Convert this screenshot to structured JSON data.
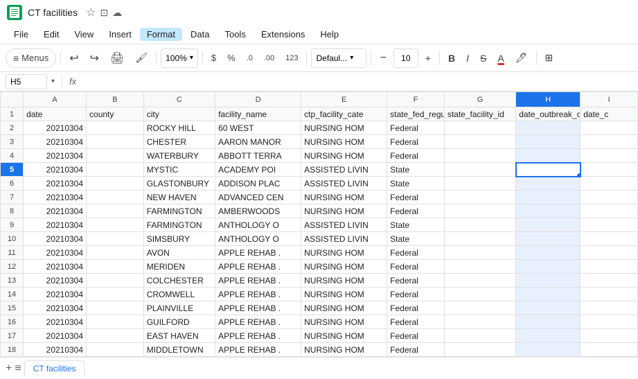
{
  "titleBar": {
    "title": "CT facilities",
    "icons": [
      "star",
      "doc",
      "cloud"
    ]
  },
  "menuBar": {
    "items": [
      "File",
      "Edit",
      "View",
      "Insert",
      "Format",
      "Data",
      "Tools",
      "Extensions",
      "Help"
    ]
  },
  "toolbar": {
    "menus": "Menus",
    "zoom": "100%",
    "currency": "$",
    "percent": "%",
    "decDecrease": ".0",
    "decIncrease": ".00",
    "num123": "123",
    "fontFamily": "Defaul...",
    "minus": "−",
    "fontSize": "10",
    "plus": "+",
    "bold": "B",
    "italic": "I",
    "strikethrough": "S",
    "underline": "A"
  },
  "formulaBar": {
    "cellRef": "H5",
    "cellRefDropArrow": "▾",
    "fxLabel": "fx"
  },
  "columns": {
    "headers": [
      "",
      "A",
      "B",
      "C",
      "D",
      "E",
      "F",
      "G",
      "H",
      "I"
    ]
  },
  "rows": [
    {
      "num": "1",
      "a": "date",
      "b": "county",
      "c": "city",
      "d": "facility_name",
      "e": "ctp_facility_cate",
      "f": "state_fed_regula",
      "g": "state_facility_id",
      "h": "date_outbreak_c",
      "i": "date_c"
    },
    {
      "num": "2",
      "a": "20210304",
      "b": "",
      "c": "ROCKY HILL",
      "d": "60 WEST",
      "e": "NURSING HOM",
      "f": "Federal",
      "g": "",
      "h": "",
      "i": ""
    },
    {
      "num": "3",
      "a": "20210304",
      "b": "",
      "c": "CHESTER",
      "d": "AARON MANOR",
      "e": "NURSING HOM",
      "f": "Federal",
      "g": "",
      "h": "",
      "i": ""
    },
    {
      "num": "4",
      "a": "20210304",
      "b": "",
      "c": "WATERBURY",
      "d": "ABBOTT TERRA",
      "e": "NURSING HOM",
      "f": "Federal",
      "g": "",
      "h": "",
      "i": ""
    },
    {
      "num": "5",
      "a": "20210304",
      "b": "",
      "c": "MYSTIC",
      "d": "ACADEMY POI",
      "e": "ASSISTED LIVIN",
      "f": "State",
      "g": "",
      "h": "",
      "i": ""
    },
    {
      "num": "6",
      "a": "20210304",
      "b": "",
      "c": "GLASTONBURY",
      "d": "ADDISON PLAC",
      "e": "ASSISTED LIVIN",
      "f": "State",
      "g": "",
      "h": "",
      "i": ""
    },
    {
      "num": "7",
      "a": "20210304",
      "b": "",
      "c": "NEW HAVEN",
      "d": "ADVANCED CEN",
      "e": "NURSING HOM",
      "f": "Federal",
      "g": "",
      "h": "",
      "i": ""
    },
    {
      "num": "8",
      "a": "20210304",
      "b": "",
      "c": "FARMINGTON",
      "d": "AMBERWOODS",
      "e": "NURSING HOM",
      "f": "Federal",
      "g": "",
      "h": "",
      "i": ""
    },
    {
      "num": "9",
      "a": "20210304",
      "b": "",
      "c": "FARMINGTON",
      "d": "ANTHOLOGY O",
      "e": "ASSISTED LIVIN",
      "f": "State",
      "g": "",
      "h": "",
      "i": ""
    },
    {
      "num": "10",
      "a": "20210304",
      "b": "",
      "c": "SIMSBURY",
      "d": "ANTHOLOGY O",
      "e": "ASSISTED LIVIN",
      "f": "State",
      "g": "",
      "h": "",
      "i": ""
    },
    {
      "num": "11",
      "a": "20210304",
      "b": "",
      "c": "AVON",
      "d": "APPLE REHAB .",
      "e": "NURSING HOM",
      "f": "Federal",
      "g": "",
      "h": "",
      "i": ""
    },
    {
      "num": "12",
      "a": "20210304",
      "b": "",
      "c": "MERIDEN",
      "d": "APPLE REHAB .",
      "e": "NURSING HOM",
      "f": "Federal",
      "g": "",
      "h": "",
      "i": ""
    },
    {
      "num": "13",
      "a": "20210304",
      "b": "",
      "c": "COLCHESTER",
      "d": "APPLE REHAB .",
      "e": "NURSING HOM",
      "f": "Federal",
      "g": "",
      "h": "",
      "i": ""
    },
    {
      "num": "14",
      "a": "20210304",
      "b": "",
      "c": "CROMWELL",
      "d": "APPLE REHAB .",
      "e": "NURSING HOM",
      "f": "Federal",
      "g": "",
      "h": "",
      "i": ""
    },
    {
      "num": "15",
      "a": "20210304",
      "b": "",
      "c": "PLAINVILLE",
      "d": "APPLE REHAB .",
      "e": "NURSING HOM",
      "f": "Federal",
      "g": "",
      "h": "",
      "i": ""
    },
    {
      "num": "16",
      "a": "20210304",
      "b": "",
      "c": "GUILFORD",
      "d": "APPLE REHAB .",
      "e": "NURSING HOM",
      "f": "Federal",
      "g": "",
      "h": "",
      "i": ""
    },
    {
      "num": "17",
      "a": "20210304",
      "b": "",
      "c": "EAST HAVEN",
      "d": "APPLE REHAB .",
      "e": "NURSING HOM",
      "f": "Federal",
      "g": "",
      "h": "",
      "i": ""
    },
    {
      "num": "18",
      "a": "20210304",
      "b": "",
      "c": "MIDDLETOWN",
      "d": "APPLE REHAB .",
      "e": "NURSING HOM",
      "f": "Federal",
      "g": "",
      "h": "",
      "i": ""
    }
  ],
  "bottomBar": {
    "sheetName": "CT facilities"
  }
}
